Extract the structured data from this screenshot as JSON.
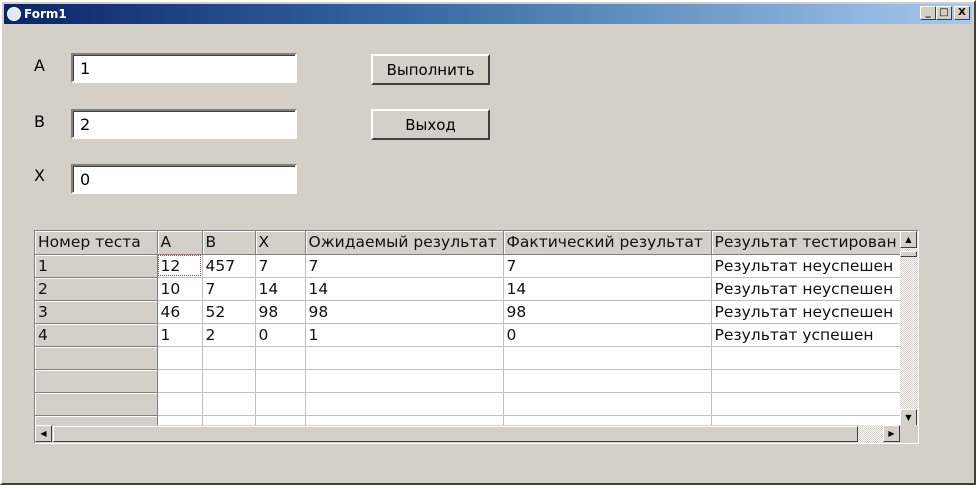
{
  "window": {
    "title": "Form1",
    "minimize": "_",
    "maximize": "□",
    "close": "X"
  },
  "fields": [
    {
      "label": "A",
      "value": "1"
    },
    {
      "label": "B",
      "value": "2"
    },
    {
      "label": "X",
      "value": "0"
    }
  ],
  "buttons": {
    "run": "Выполнить",
    "exit": "Выход"
  },
  "grid": {
    "headers": [
      "Номер теста",
      "A",
      "B",
      "X",
      "Ожидаемый результат",
      "Фактический результат",
      "Результат тестирован"
    ],
    "rows": [
      [
        "1",
        "12",
        "457",
        "7",
        "7",
        "7",
        "Результат неуспешен"
      ],
      [
        "2",
        "10",
        "7",
        "14",
        "14",
        "14",
        "Результат неуспешен"
      ],
      [
        "3",
        "46",
        "52",
        "98",
        "98",
        "98",
        "Результат неуспешен"
      ],
      [
        "4",
        "1",
        "2",
        "0",
        "1",
        "0",
        "Результат успешен"
      ]
    ],
    "empty_rows": 4
  }
}
